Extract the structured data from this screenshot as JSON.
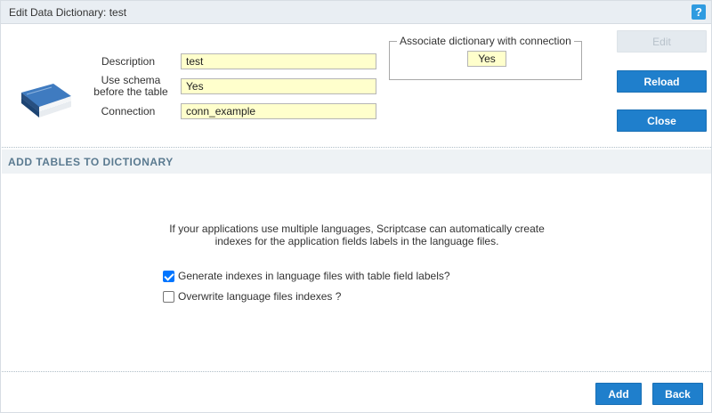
{
  "window": {
    "title": "Edit Data Dictionary: test",
    "help_label": "?"
  },
  "form": {
    "description_label": "Description",
    "description_value": "test",
    "schema_label_line1": "Use schema",
    "schema_label_line2": "before the table",
    "schema_value": "Yes",
    "connection_label": "Connection",
    "connection_value": "conn_example"
  },
  "associate": {
    "legend": "Associate dictionary with connection",
    "value": "Yes"
  },
  "side_buttons": {
    "edit": "Edit",
    "reload": "Reload",
    "close": "Close"
  },
  "section": {
    "title": "ADD TABLES TO DICTIONARY",
    "info_line1": "If your applications use multiple languages, Scriptcase can automatically create",
    "info_line2": "indexes for the application fields labels in the language files.",
    "option_generate": "Generate indexes in language files with table field labels?",
    "option_generate_checked": true,
    "option_overwrite": "Overwrite language files indexes ?",
    "option_overwrite_checked": false
  },
  "footer": {
    "add": "Add",
    "back": "Back"
  },
  "icons": {
    "book": "book-icon",
    "help": "help-icon",
    "check": "checkbox-icon"
  },
  "colors": {
    "primary": "#1f7fcc",
    "input_bg": "#ffffcc",
    "header_bg": "#e9eef3",
    "section_text": "#5a7a90"
  }
}
